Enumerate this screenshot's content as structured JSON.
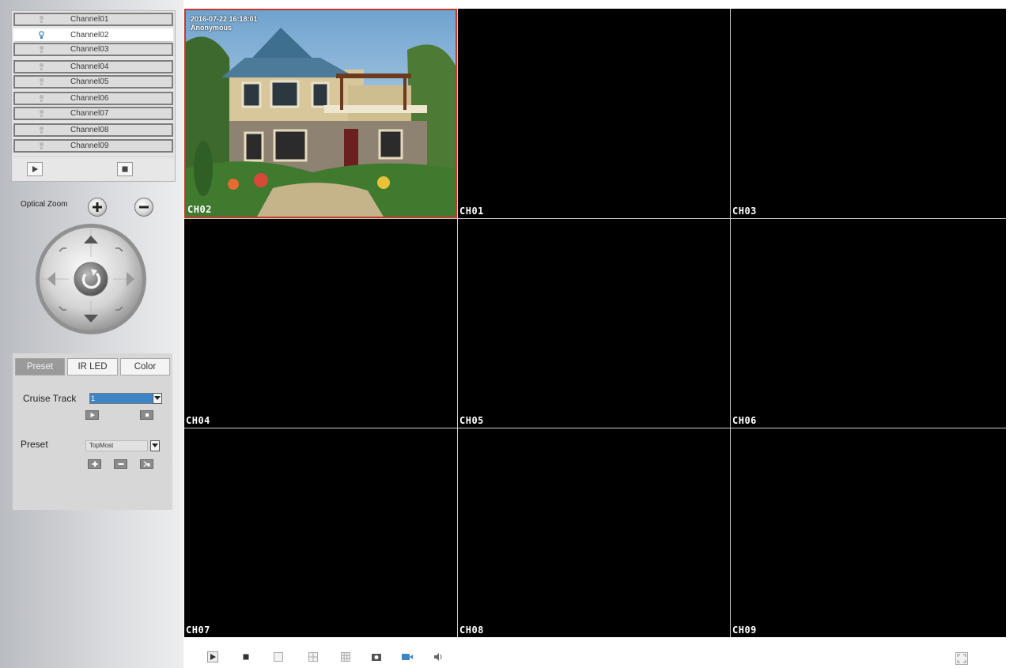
{
  "channels": [
    {
      "label": "Channel01",
      "active": false
    },
    {
      "label": "Channel02",
      "active": true
    },
    {
      "label": "Channel03",
      "active": false
    },
    {
      "label": "Channel04",
      "active": false
    },
    {
      "label": "Channel05",
      "active": false
    },
    {
      "label": "Channel06",
      "active": false
    },
    {
      "label": "Channel07",
      "active": false
    },
    {
      "label": "Channel08",
      "active": false
    },
    {
      "label": "Channel09",
      "active": false
    }
  ],
  "ptz": {
    "zoom_label": "Optical Zoom"
  },
  "tabs": {
    "preset": "Preset",
    "ir_led": "IR LED",
    "color": "Color"
  },
  "cruise": {
    "label": "Cruise Track",
    "value": "1"
  },
  "preset": {
    "label": "Preset",
    "value": "TopMost"
  },
  "video": {
    "osd_time": "2016-07-22 16:18:01",
    "osd_user": "Anonymous",
    "cells": [
      "CH02",
      "CH01",
      "CH03",
      "CH04",
      "CH05",
      "CH06",
      "CH07",
      "CH08",
      "CH09"
    ]
  },
  "colors": {
    "selected_border": "#c0392b",
    "accent_blue": "#3d85c6"
  },
  "icons": {
    "toolbar": [
      "play-icon",
      "stop-icon",
      "single-view-icon",
      "quad-view-icon",
      "nine-view-icon",
      "snapshot-icon",
      "record-icon",
      "audio-icon",
      "fullscreen-icon"
    ]
  }
}
